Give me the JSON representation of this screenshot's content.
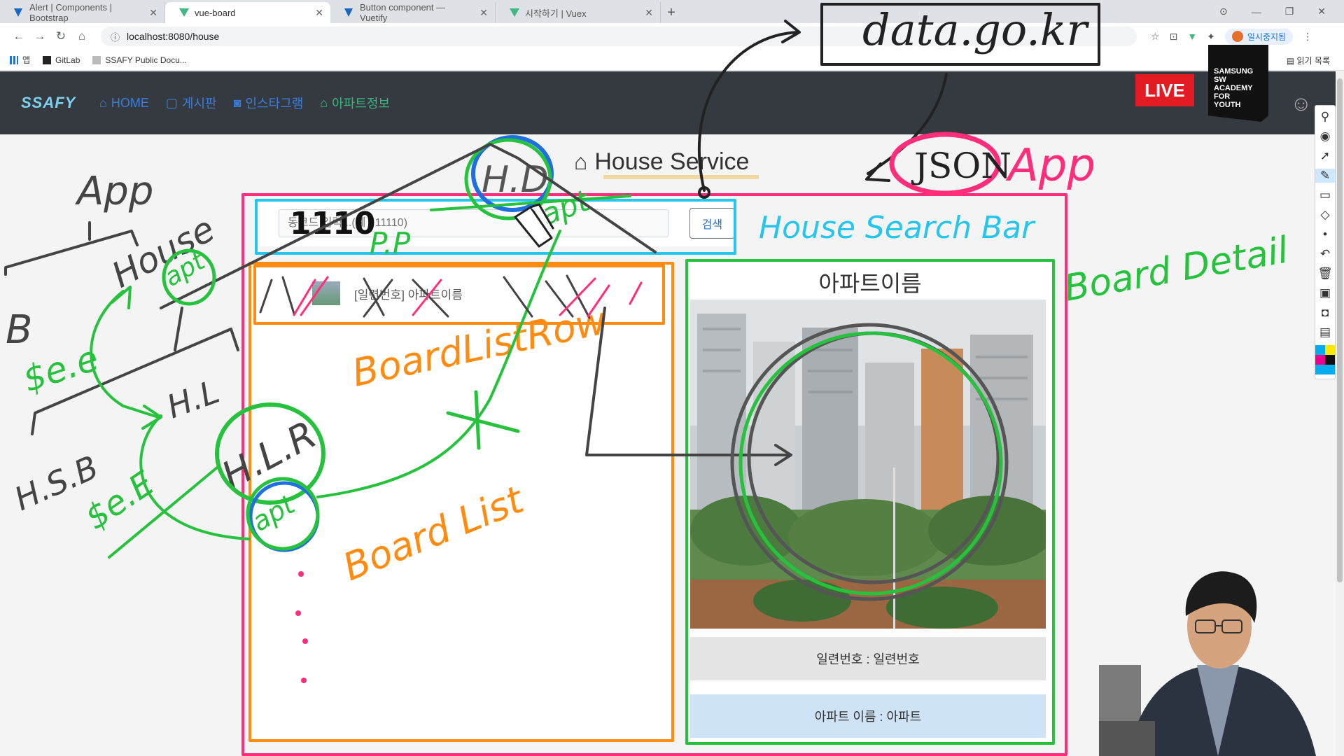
{
  "browser": {
    "tabs": [
      {
        "title": "Alert | Components | Bootstrap",
        "active": false
      },
      {
        "title": "vue-board",
        "active": true
      },
      {
        "title": "Button component — Vuetify",
        "active": false
      },
      {
        "title": "시작하기 | Vuex",
        "active": false
      }
    ],
    "new_tab": "+",
    "url": "localhost:8080/house",
    "profile_label": "일시중지됨",
    "bookmarks": [
      {
        "label": "앱"
      },
      {
        "label": "GitLab"
      },
      {
        "label": "SSAFY Public Docu..."
      }
    ],
    "reading_list": "읽기 목록"
  },
  "navbar": {
    "logo": "SSAFY",
    "items": [
      {
        "label": "HOME",
        "icon": "home-icon"
      },
      {
        "label": "게시판",
        "icon": "board-icon"
      },
      {
        "label": "인스타그램",
        "icon": "instagram-icon"
      },
      {
        "label": "아파트정보",
        "icon": "house-icon"
      }
    ],
    "live_badge": "LIVE",
    "samsung_badge": [
      "SAMSUNG",
      "SW",
      "ACADEMY",
      "FOR",
      "YOUTH"
    ]
  },
  "page": {
    "title": "House Service",
    "search": {
      "placeholder": "동코드 입력...(예 : 11110)",
      "button": "검색"
    },
    "list": {
      "row_text": "[일련번호] 아파트이름"
    },
    "detail": {
      "title": "아파트이름",
      "serial_line": "일련번호 : 일련번호",
      "name_line": "아파트 이름 : 아파트"
    }
  },
  "annotations": {
    "data_source": "data.go.kr",
    "json": "JSON",
    "app_right": "App",
    "app_left": "App",
    "house_left": "House",
    "apt": "apt",
    "b": "B",
    "se1": "$e.e",
    "hl": "H.L",
    "hsb": "H.S.B",
    "se2": "$e.E",
    "hlr": "H.L.R",
    "apt2": "apt",
    "hd": "H.D",
    "pp": "P.P",
    "apt3": "apt",
    "search_bar_label": "House Search Bar",
    "board_detail": "Board Detail",
    "board_list_row": "BoardListRow",
    "board_list": "Board List",
    "input_scribble": "1110"
  },
  "colors": {
    "pink": "#ff2d7a",
    "cyan": "#25c6ee",
    "orange": "#ff8c10",
    "green": "#27c23d",
    "blue": "#1e6fe0",
    "dark": "#222222",
    "navbar": "#343a40"
  }
}
